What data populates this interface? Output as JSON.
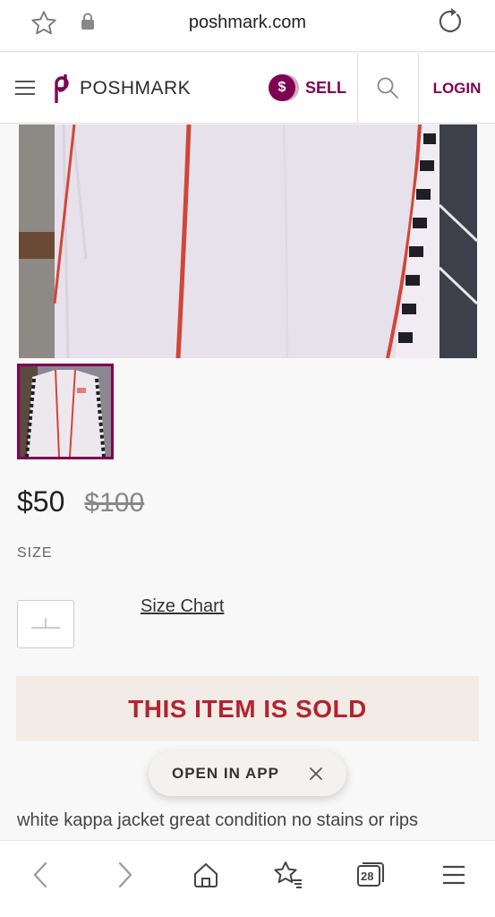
{
  "browser": {
    "domain": "poshmark.com",
    "tab_count": "28"
  },
  "header": {
    "brand": "POSHMARK",
    "sell_label": "SELL",
    "sell_coin": "$",
    "login_label": "LOGIN"
  },
  "product": {
    "price": "$50",
    "original_price": "$100",
    "size_label": "SIZE",
    "size_chart_label": "Size Chart",
    "sold_message": "THIS ITEM IS SOLD",
    "description": "white kappa jacket great condition no stains or rips"
  },
  "app_prompt": {
    "label": "OPEN IN APP"
  },
  "colors": {
    "brand": "#7f0353",
    "sold_text": "#b22430",
    "sold_bg": "#f3ece6"
  }
}
